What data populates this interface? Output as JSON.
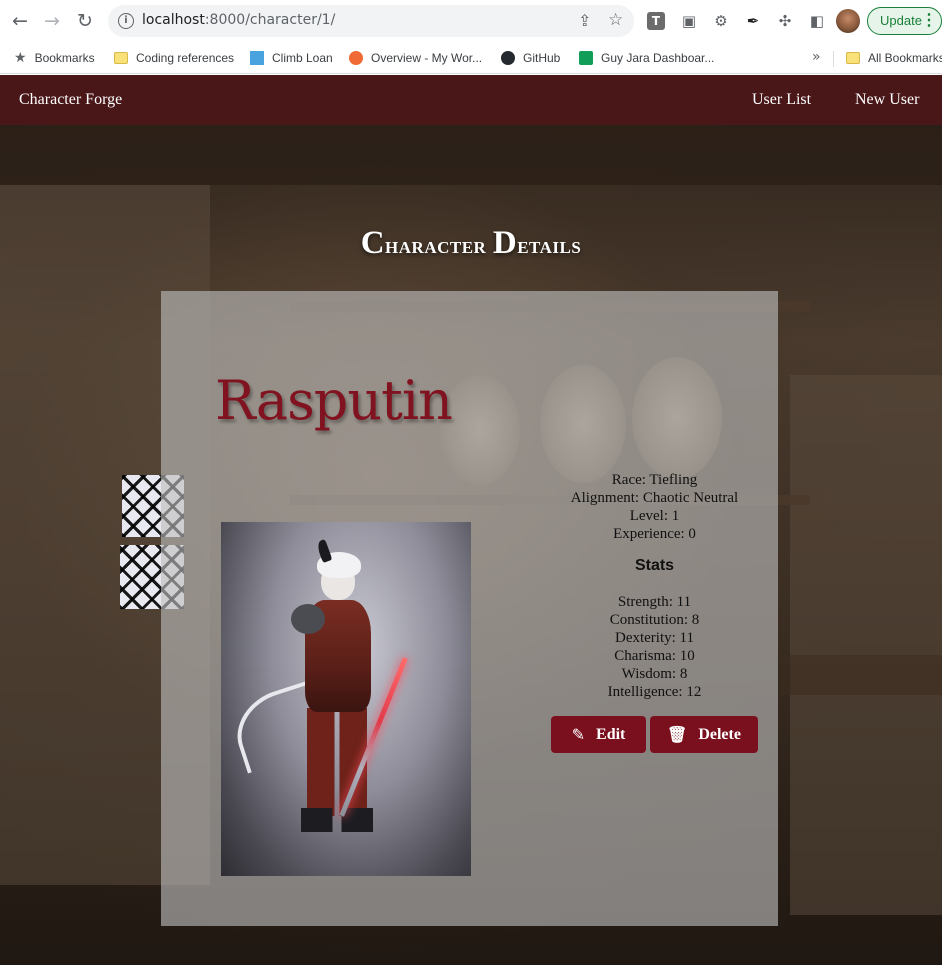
{
  "browser": {
    "url_host": "localhost",
    "url_rest": ":8000/character/1/",
    "update_label": "Update",
    "more_menu": "⋮",
    "bookmarks": [
      {
        "label": "Bookmarks",
        "icon": "star-icon"
      },
      {
        "label": "Coding references",
        "icon": "folder-icon"
      },
      {
        "label": "Climb Loan",
        "icon": "bookmark-icon"
      },
      {
        "label": "Overview - My Wor...",
        "icon": "bookmark-icon"
      },
      {
        "label": "GitHub",
        "icon": "github-icon"
      },
      {
        "label": "Guy Jara Dashboar...",
        "icon": "sheets-icon"
      }
    ],
    "bookmarks_overflow": "»",
    "all_bookmarks": "All Bookmarks"
  },
  "nav": {
    "brand": "Character Forge",
    "links": [
      "User List",
      "New User"
    ]
  },
  "page": {
    "heading_first": "C",
    "heading_rest": "haracter ",
    "heading_second": "D",
    "heading_rest2": "etails"
  },
  "character": {
    "name": "Rasputin",
    "race": "Race: Tiefling",
    "alignment": "Alignment: Chaotic Neutral",
    "level": "Level: 1",
    "experience": "Experience: 0",
    "stats_title": "Stats",
    "stats": [
      "Strength: 11",
      "Constitution: 8",
      "Dexterity: 11",
      "Charisma: 10",
      "Wisdom: 8",
      "Intelligence: 12"
    ]
  },
  "actions": {
    "edit_label": "Edit",
    "delete_label": "Delete",
    "edit_icon": "✎",
    "delete_icon": "🗑"
  },
  "colors": {
    "navbar": "#4a1719",
    "accent": "#7a0f1e",
    "name_color": "#80131f"
  }
}
